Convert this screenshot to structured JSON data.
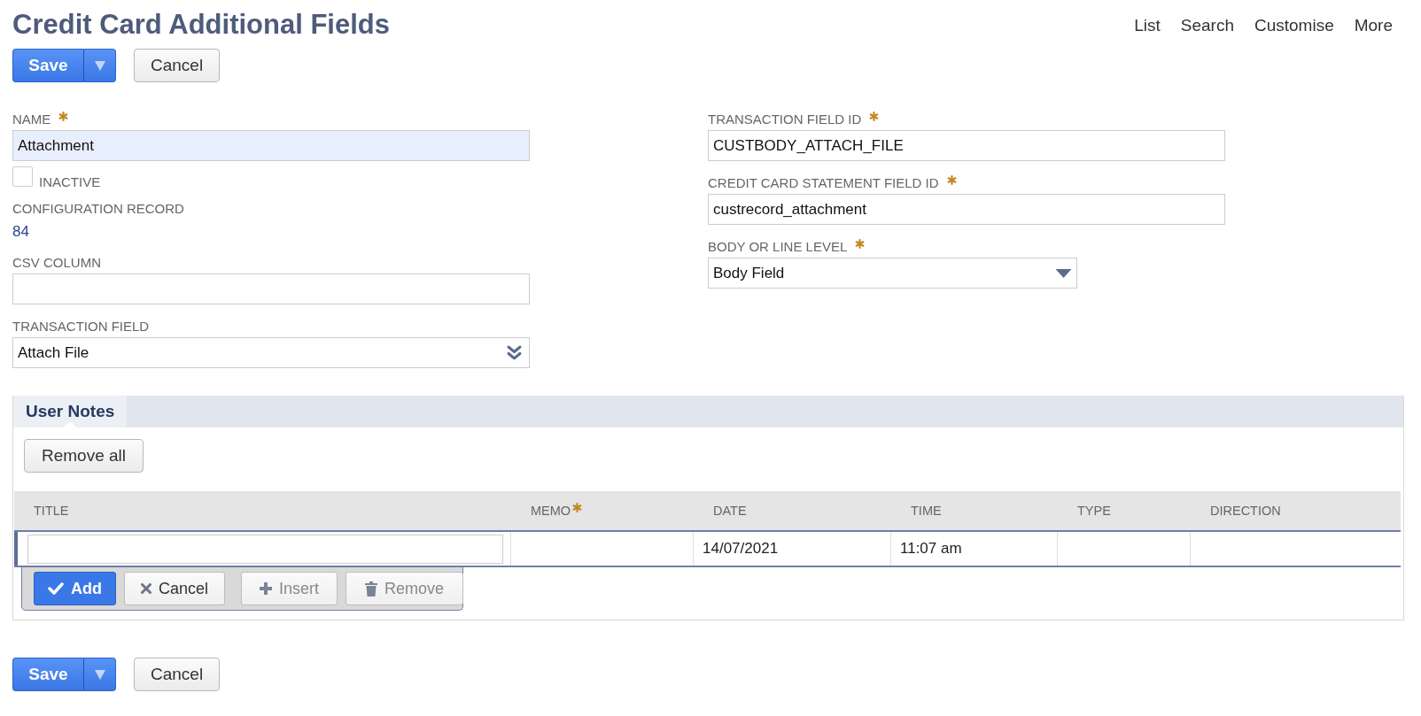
{
  "page": {
    "title": "Credit Card Additional Fields"
  },
  "nav_links": [
    "List",
    "Search",
    "Customise",
    "More"
  ],
  "header_buttons": [
    {
      "kind": "split_primary",
      "label": "Save"
    },
    {
      "kind": "secondary",
      "label": "Cancel"
    }
  ],
  "form": {
    "left_column": [
      {
        "kind": "text",
        "label": "NAME",
        "required": true,
        "highlighted": true,
        "value": "Attachment"
      },
      {
        "kind": "checkbox",
        "label": "INACTIVE",
        "required": false,
        "checked": false
      },
      {
        "kind": "link",
        "label": "CONFIGURATION RECORD",
        "required": false,
        "value": "84"
      },
      {
        "kind": "text",
        "label": "CSV COLUMN",
        "required": false,
        "highlighted": false
      },
      {
        "kind": "popup_select",
        "label": "TRANSACTION FIELD",
        "required": false,
        "highlighted": false,
        "value": "Attach File"
      }
    ],
    "right_column": [
      {
        "kind": "text",
        "label": "TRANSACTION FIELD ID",
        "required": true,
        "highlighted": false,
        "value": "CUSTBODY_ATTACH_FILE"
      },
      {
        "kind": "text",
        "label": "CREDIT CARD STATEMENT FIELD ID",
        "required": true,
        "highlighted": false,
        "value": "custrecord_attachment"
      },
      {
        "kind": "select",
        "label": "BODY OR LINE LEVEL",
        "required": true,
        "highlighted": false,
        "value": "Body Field"
      }
    ]
  },
  "user_notes": {
    "tabs": [
      {
        "label": "User Notes",
        "selected": true
      }
    ],
    "remove_all_button": "Remove all",
    "table": {
      "columns": [
        {
          "label": "TITLE",
          "required": false
        },
        {
          "label": "MEMO",
          "required": true
        },
        {
          "label": "DATE",
          "required": false
        },
        {
          "label": "TIME",
          "required": false
        },
        {
          "label": "TYPE",
          "required": false
        },
        {
          "label": "DIRECTION",
          "required": false
        }
      ],
      "rows": [
        {
          "editing": true,
          "cells": [
            {
              "kind": "input"
            },
            {
              "kind": "text"
            },
            {
              "kind": "text",
              "value": "14/07/2021"
            },
            {
              "kind": "text",
              "value": "11:07 am"
            },
            {
              "kind": "text"
            },
            {
              "kind": "text"
            }
          ]
        }
      ]
    },
    "line_actions": [
      {
        "kind": "add",
        "label": "Add",
        "disabled": false
      },
      {
        "kind": "cancel",
        "label": "Cancel",
        "disabled": false
      },
      {
        "kind": "insert",
        "label": "Insert",
        "disabled": true
      },
      {
        "kind": "remove",
        "label": "Remove",
        "disabled": true
      }
    ]
  },
  "footer_buttons": [
    {
      "kind": "split_primary",
      "label": "Save"
    },
    {
      "kind": "secondary",
      "label": "Cancel"
    }
  ]
}
